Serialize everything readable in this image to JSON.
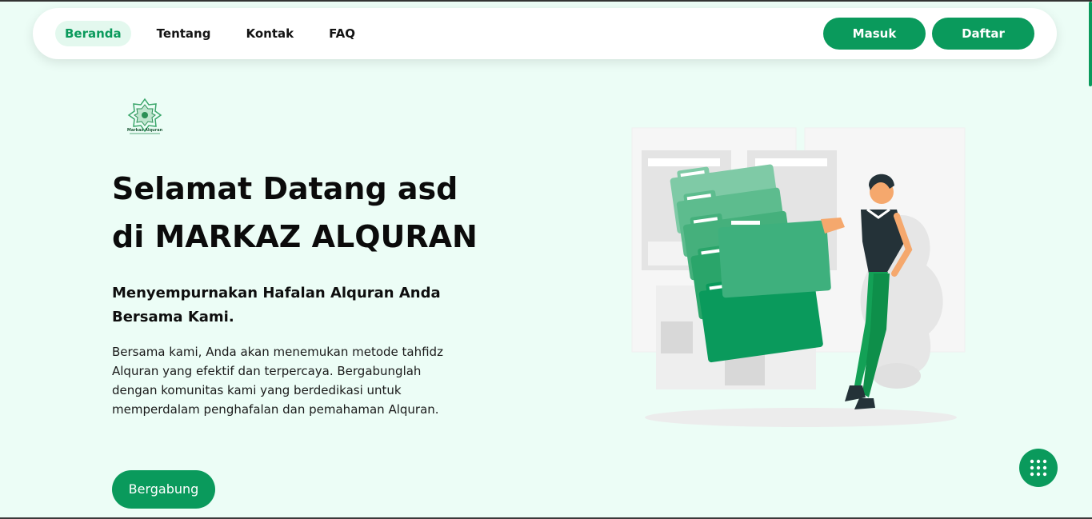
{
  "nav": {
    "links": [
      "Beranda",
      "Tentang",
      "Kontak",
      "FAQ"
    ],
    "active": "Beranda",
    "login_label": "Masuk",
    "register_label": "Daftar"
  },
  "logo": {
    "text": "Markaz Alquran",
    "icon": "markaz-alquran-logo"
  },
  "hero": {
    "title_line1": "Selamat Datang asd",
    "title_line2": "di MARKAZ ALQURAN",
    "subtitle": "Menyempurnakan Hafalan Alquran Anda Bersama Kami.",
    "description": "Bersama kami, Anda akan menemukan metode tahfidz Alquran yang efektif dan terpercaya. Bergabunglah dengan komunitas kami yang berdedikasi untuk memperdalam penghafalan dan pemahaman Alquran.",
    "join_label": "Bergabung"
  },
  "illustration": {
    "icon": "person-carrying-folders-illustration"
  },
  "fab": {
    "icon": "grid-dots-icon"
  },
  "colors": {
    "accent": "#0a9a5c",
    "background": "#ecfdf6",
    "active_bg": "#e3f8ee"
  }
}
